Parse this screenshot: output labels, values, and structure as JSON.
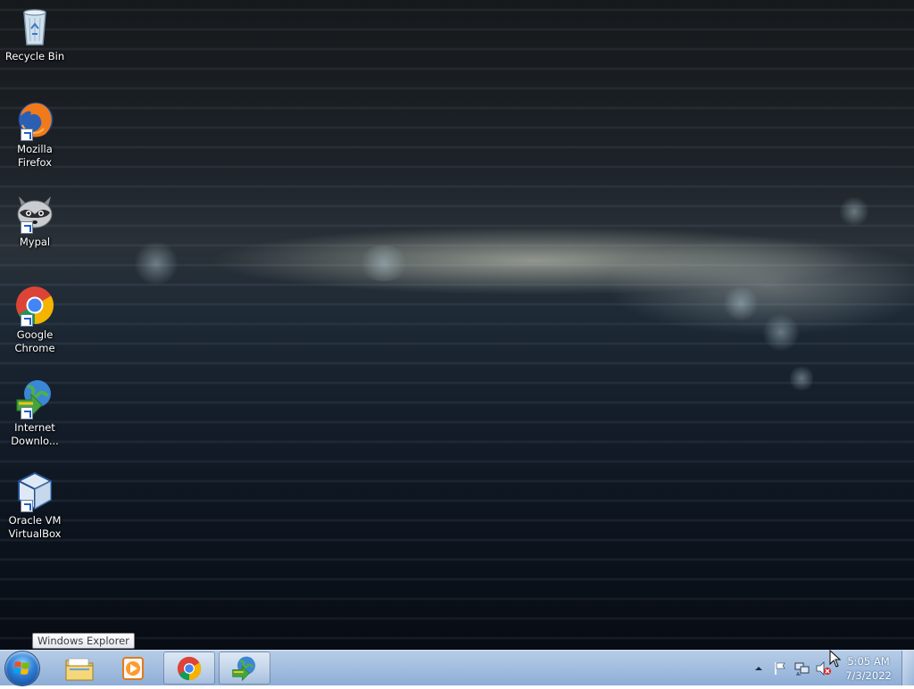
{
  "desktop_icons": [
    {
      "label": "Recycle Bin",
      "icon": "recycle-bin-icon",
      "shortcut": false
    },
    {
      "label": "Mozilla Firefox",
      "icon": "firefox-icon",
      "shortcut": true
    },
    {
      "label": "Mypal",
      "icon": "mypal-icon",
      "shortcut": true
    },
    {
      "label": "Google Chrome",
      "icon": "chrome-icon",
      "shortcut": true
    },
    {
      "label": "Internet Downlo...",
      "icon": "internet-download-manager-icon",
      "shortcut": true
    },
    {
      "label": "Oracle VM VirtualBox",
      "icon": "virtualbox-icon",
      "shortcut": true
    }
  ],
  "tooltip": {
    "text": "Windows Explorer"
  },
  "taskbar": {
    "buttons": [
      {
        "icon": "windows-explorer-icon",
        "active": false
      },
      {
        "icon": "media-player-icon",
        "active": false
      },
      {
        "icon": "chrome-icon",
        "active": true
      },
      {
        "icon": "internet-download-manager-icon",
        "active": true
      }
    ]
  },
  "tray": {
    "icons": [
      "show-hidden-icons-chevron",
      "action-center-flag-icon",
      "network-icon",
      "volume-muted-icon"
    ],
    "clock": {
      "time": "5:05 AM",
      "date": "7/3/2022"
    }
  },
  "colors": {
    "taskbar": "#a4bfdf",
    "accent_blue": "#2e7cd3"
  }
}
